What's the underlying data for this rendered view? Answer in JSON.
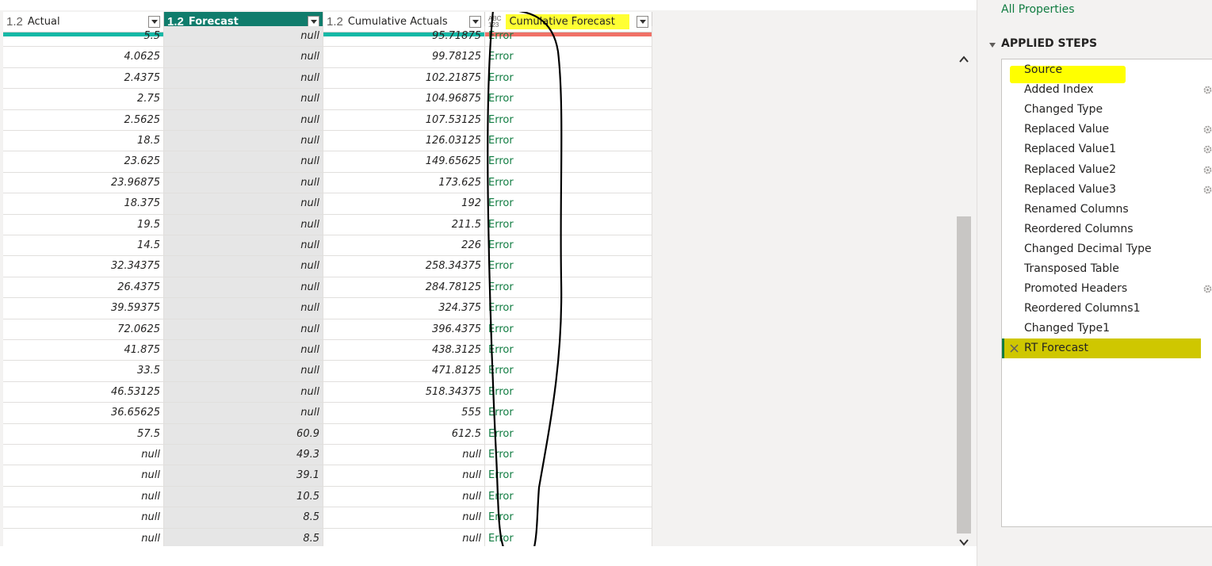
{
  "columns": [
    {
      "type": "1.2",
      "name": "Actual",
      "selected": false
    },
    {
      "type": "1.2",
      "name": "Forecast",
      "selected": true
    },
    {
      "type": "1.2",
      "name": "Cumulative Actuals",
      "selected": false
    },
    {
      "type_top": "ABC",
      "type_bottom": "123",
      "name": "Cumulative Forecast",
      "selected": false
    }
  ],
  "rows": [
    {
      "actual": "5.5",
      "forecast": "null",
      "cumact": "95.71875",
      "cumfc": "Error"
    },
    {
      "actual": "4.0625",
      "forecast": "null",
      "cumact": "99.78125",
      "cumfc": "Error"
    },
    {
      "actual": "2.4375",
      "forecast": "null",
      "cumact": "102.21875",
      "cumfc": "Error"
    },
    {
      "actual": "2.75",
      "forecast": "null",
      "cumact": "104.96875",
      "cumfc": "Error"
    },
    {
      "actual": "2.5625",
      "forecast": "null",
      "cumact": "107.53125",
      "cumfc": "Error"
    },
    {
      "actual": "18.5",
      "forecast": "null",
      "cumact": "126.03125",
      "cumfc": "Error"
    },
    {
      "actual": "23.625",
      "forecast": "null",
      "cumact": "149.65625",
      "cumfc": "Error"
    },
    {
      "actual": "23.96875",
      "forecast": "null",
      "cumact": "173.625",
      "cumfc": "Error"
    },
    {
      "actual": "18.375",
      "forecast": "null",
      "cumact": "192",
      "cumfc": "Error"
    },
    {
      "actual": "19.5",
      "forecast": "null",
      "cumact": "211.5",
      "cumfc": "Error"
    },
    {
      "actual": "14.5",
      "forecast": "null",
      "cumact": "226",
      "cumfc": "Error"
    },
    {
      "actual": "32.34375",
      "forecast": "null",
      "cumact": "258.34375",
      "cumfc": "Error"
    },
    {
      "actual": "26.4375",
      "forecast": "null",
      "cumact": "284.78125",
      "cumfc": "Error"
    },
    {
      "actual": "39.59375",
      "forecast": "null",
      "cumact": "324.375",
      "cumfc": "Error"
    },
    {
      "actual": "72.0625",
      "forecast": "null",
      "cumact": "396.4375",
      "cumfc": "Error"
    },
    {
      "actual": "41.875",
      "forecast": "null",
      "cumact": "438.3125",
      "cumfc": "Error"
    },
    {
      "actual": "33.5",
      "forecast": "null",
      "cumact": "471.8125",
      "cumfc": "Error"
    },
    {
      "actual": "46.53125",
      "forecast": "null",
      "cumact": "518.34375",
      "cumfc": "Error"
    },
    {
      "actual": "36.65625",
      "forecast": "null",
      "cumact": "555",
      "cumfc": "Error"
    },
    {
      "actual": "57.5",
      "forecast": "60.9",
      "cumact": "612.5",
      "cumfc": "Error"
    },
    {
      "actual": "null",
      "forecast": "49.3",
      "cumact": "null",
      "cumfc": "Error"
    },
    {
      "actual": "null",
      "forecast": "39.1",
      "cumact": "null",
      "cumfc": "Error"
    },
    {
      "actual": "null",
      "forecast": "10.5",
      "cumact": "null",
      "cumfc": "Error"
    },
    {
      "actual": "null",
      "forecast": "8.5",
      "cumact": "null",
      "cumfc": "Error"
    },
    {
      "actual": "null",
      "forecast": "8.5",
      "cumact": "null",
      "cumfc": "Error"
    }
  ],
  "right_pane": {
    "all_properties": "All Properties",
    "applied_steps_title": "APPLIED STEPS",
    "steps": [
      {
        "label": "Source",
        "gear": false
      },
      {
        "label": "Added Index",
        "gear": true
      },
      {
        "label": "Changed Type",
        "gear": false
      },
      {
        "label": "Replaced Value",
        "gear": true
      },
      {
        "label": "Replaced Value1",
        "gear": true
      },
      {
        "label": "Replaced Value2",
        "gear": true
      },
      {
        "label": "Replaced Value3",
        "gear": true
      },
      {
        "label": "Renamed Columns",
        "gear": false
      },
      {
        "label": "Reordered Columns",
        "gear": false
      },
      {
        "label": "Changed Decimal Type",
        "gear": false
      },
      {
        "label": "Transposed Table",
        "gear": false
      },
      {
        "label": "Promoted Headers",
        "gear": true
      },
      {
        "label": "Reordered Columns1",
        "gear": false
      },
      {
        "label": "Changed Type1",
        "gear": false
      },
      {
        "label": "RT Forecast",
        "gear": false,
        "current": true
      }
    ]
  },
  "colors": {
    "accent_green": "#107c6c",
    "error_text": "#107c41",
    "highlight_yellow": "#ffff00",
    "current_step": "#cfc700",
    "quality_teal": "#14b8a6",
    "quality_red": "#f07167"
  },
  "icons": [
    "dropdown-icon",
    "gear-icon",
    "close-icon",
    "chevron-up-icon",
    "chevron-down-icon"
  ]
}
